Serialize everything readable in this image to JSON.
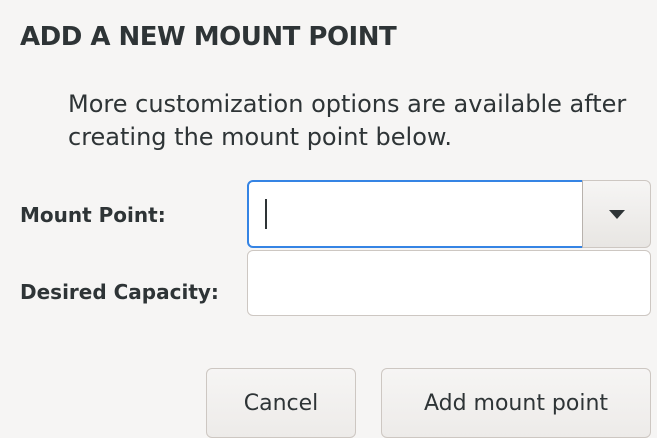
{
  "dialog": {
    "title": "ADD A NEW MOUNT POINT",
    "description": "More customization options are available after creating the mount point below."
  },
  "form": {
    "mount_point": {
      "label": "Mount Point:",
      "value": "",
      "dropdown_icon": "chevron-down-icon"
    },
    "desired_capacity": {
      "label": "Desired Capacity:",
      "value": ""
    }
  },
  "actions": {
    "cancel_label": "Cancel",
    "add_label": "Add mount point"
  },
  "colors": {
    "focus_border": "#3584e4",
    "background": "#f6f5f4",
    "text": "#2e3436"
  }
}
